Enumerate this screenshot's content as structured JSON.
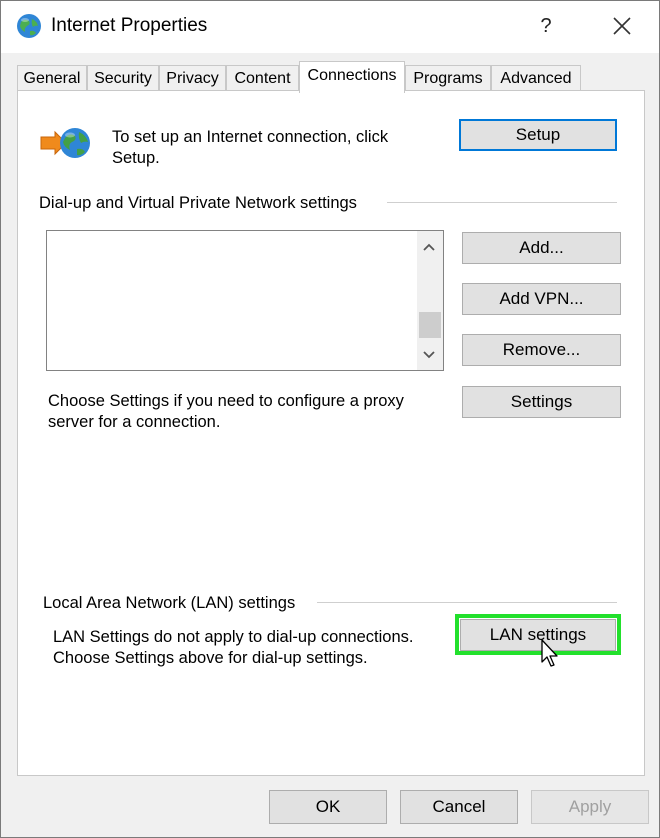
{
  "window": {
    "title": "Internet Properties",
    "help_glyph": "?",
    "close_icon": "close-icon"
  },
  "tabs": [
    {
      "label": "General",
      "active": false
    },
    {
      "label": "Security",
      "active": false
    },
    {
      "label": "Privacy",
      "active": false
    },
    {
      "label": "Content",
      "active": false
    },
    {
      "label": "Connections",
      "active": true
    },
    {
      "label": "Programs",
      "active": false
    },
    {
      "label": "Advanced",
      "active": false
    }
  ],
  "setup_section": {
    "icon": "globe-network-icon",
    "text_line1": "To set up an Internet connection, click",
    "text_line2": "Setup.",
    "setup_button": "Setup"
  },
  "dialup_section": {
    "heading": "Dial-up and Virtual Private Network settings",
    "add_button": "Add...",
    "add_vpn_button": "Add VPN...",
    "remove_button": "Remove...",
    "settings_button": "Settings",
    "proxy_text_line1": "Choose Settings if you need to configure a proxy",
    "proxy_text_line2": "server for a connection."
  },
  "lan_section": {
    "heading": "Local Area Network (LAN) settings",
    "text_line1": "LAN Settings do not apply to dial-up connections.",
    "text_line2": "Choose Settings above for dial-up settings.",
    "lan_button": "LAN settings",
    "highlight_color": "#22e02c"
  },
  "footer": {
    "ok_button": "OK",
    "cancel_button": "Cancel",
    "apply_button": "Apply"
  },
  "colors": {
    "accent": "#0078d7",
    "highlight": "#22e02c"
  }
}
